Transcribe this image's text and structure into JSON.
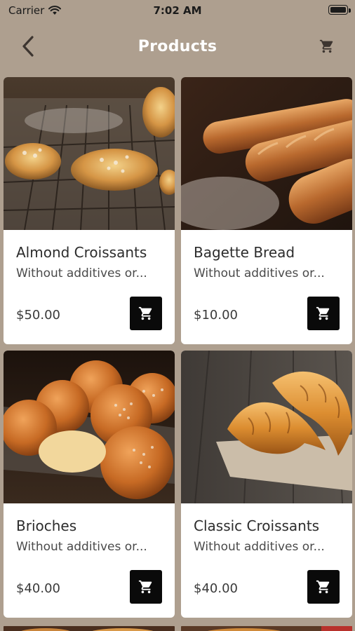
{
  "status_bar": {
    "carrier": "Carrier",
    "time": "7:02 AM"
  },
  "nav": {
    "title": "Products",
    "back_icon": "chevron-left-icon",
    "cart_icon": "cart-icon"
  },
  "products": [
    {
      "name": "Almond Croissants",
      "description": "Without additives or...",
      "price": "$50.00"
    },
    {
      "name": "Bagette Bread",
      "description": "Without additives or...",
      "price": "$10.00"
    },
    {
      "name": "Brioches",
      "description": "Without additives or...",
      "price": "$40.00"
    },
    {
      "name": "Classic Croissants",
      "description": "Without additives or...",
      "price": "$40.00"
    }
  ],
  "colors": {
    "background": "#ae9f8f",
    "card": "#ffffff",
    "button": "#0a0a0a",
    "title": "#ffffff"
  }
}
